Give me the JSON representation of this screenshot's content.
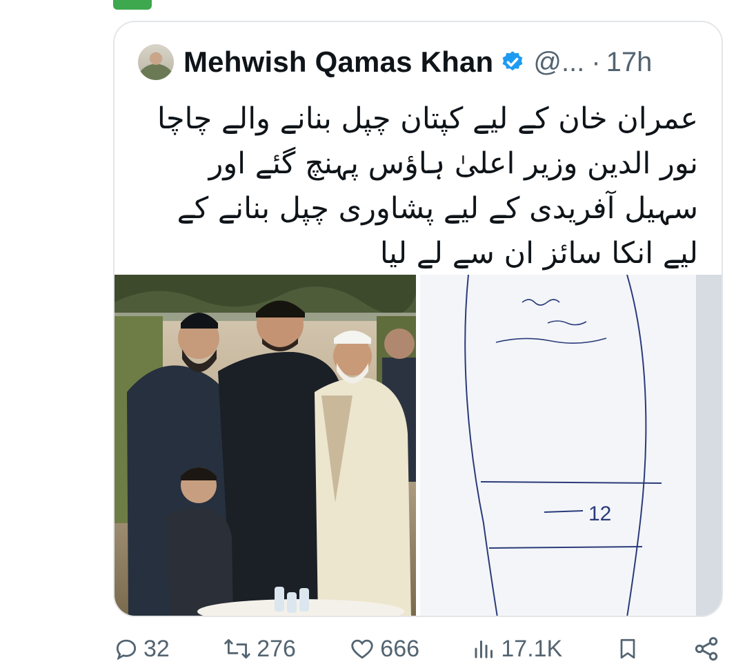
{
  "quoted_tweet": {
    "author_name": "Mehwish Qamas Khan",
    "handle": "@...",
    "separator": "·",
    "time": "17h",
    "text": "عمران خان کے لیے کپتان چپل بنانے والے چاچا نور الدین وزیر اعلیٰ ہاؤس پہنچ گئے اور سہیل آفریدی کے لیے پشاوری چپل بنانے کے لیے انکا سائز ان سے لے لیا",
    "media": [
      {
        "icon": "photo-group-portrait"
      },
      {
        "icon": "photo-foot-tracing",
        "note_number": "12"
      }
    ]
  },
  "actions": {
    "replies": "32",
    "reposts": "276",
    "likes": "666",
    "views": "17.1K"
  },
  "colors": {
    "verified": "#1d9bf0",
    "muted": "#536471",
    "border": "#e3e6e9"
  }
}
